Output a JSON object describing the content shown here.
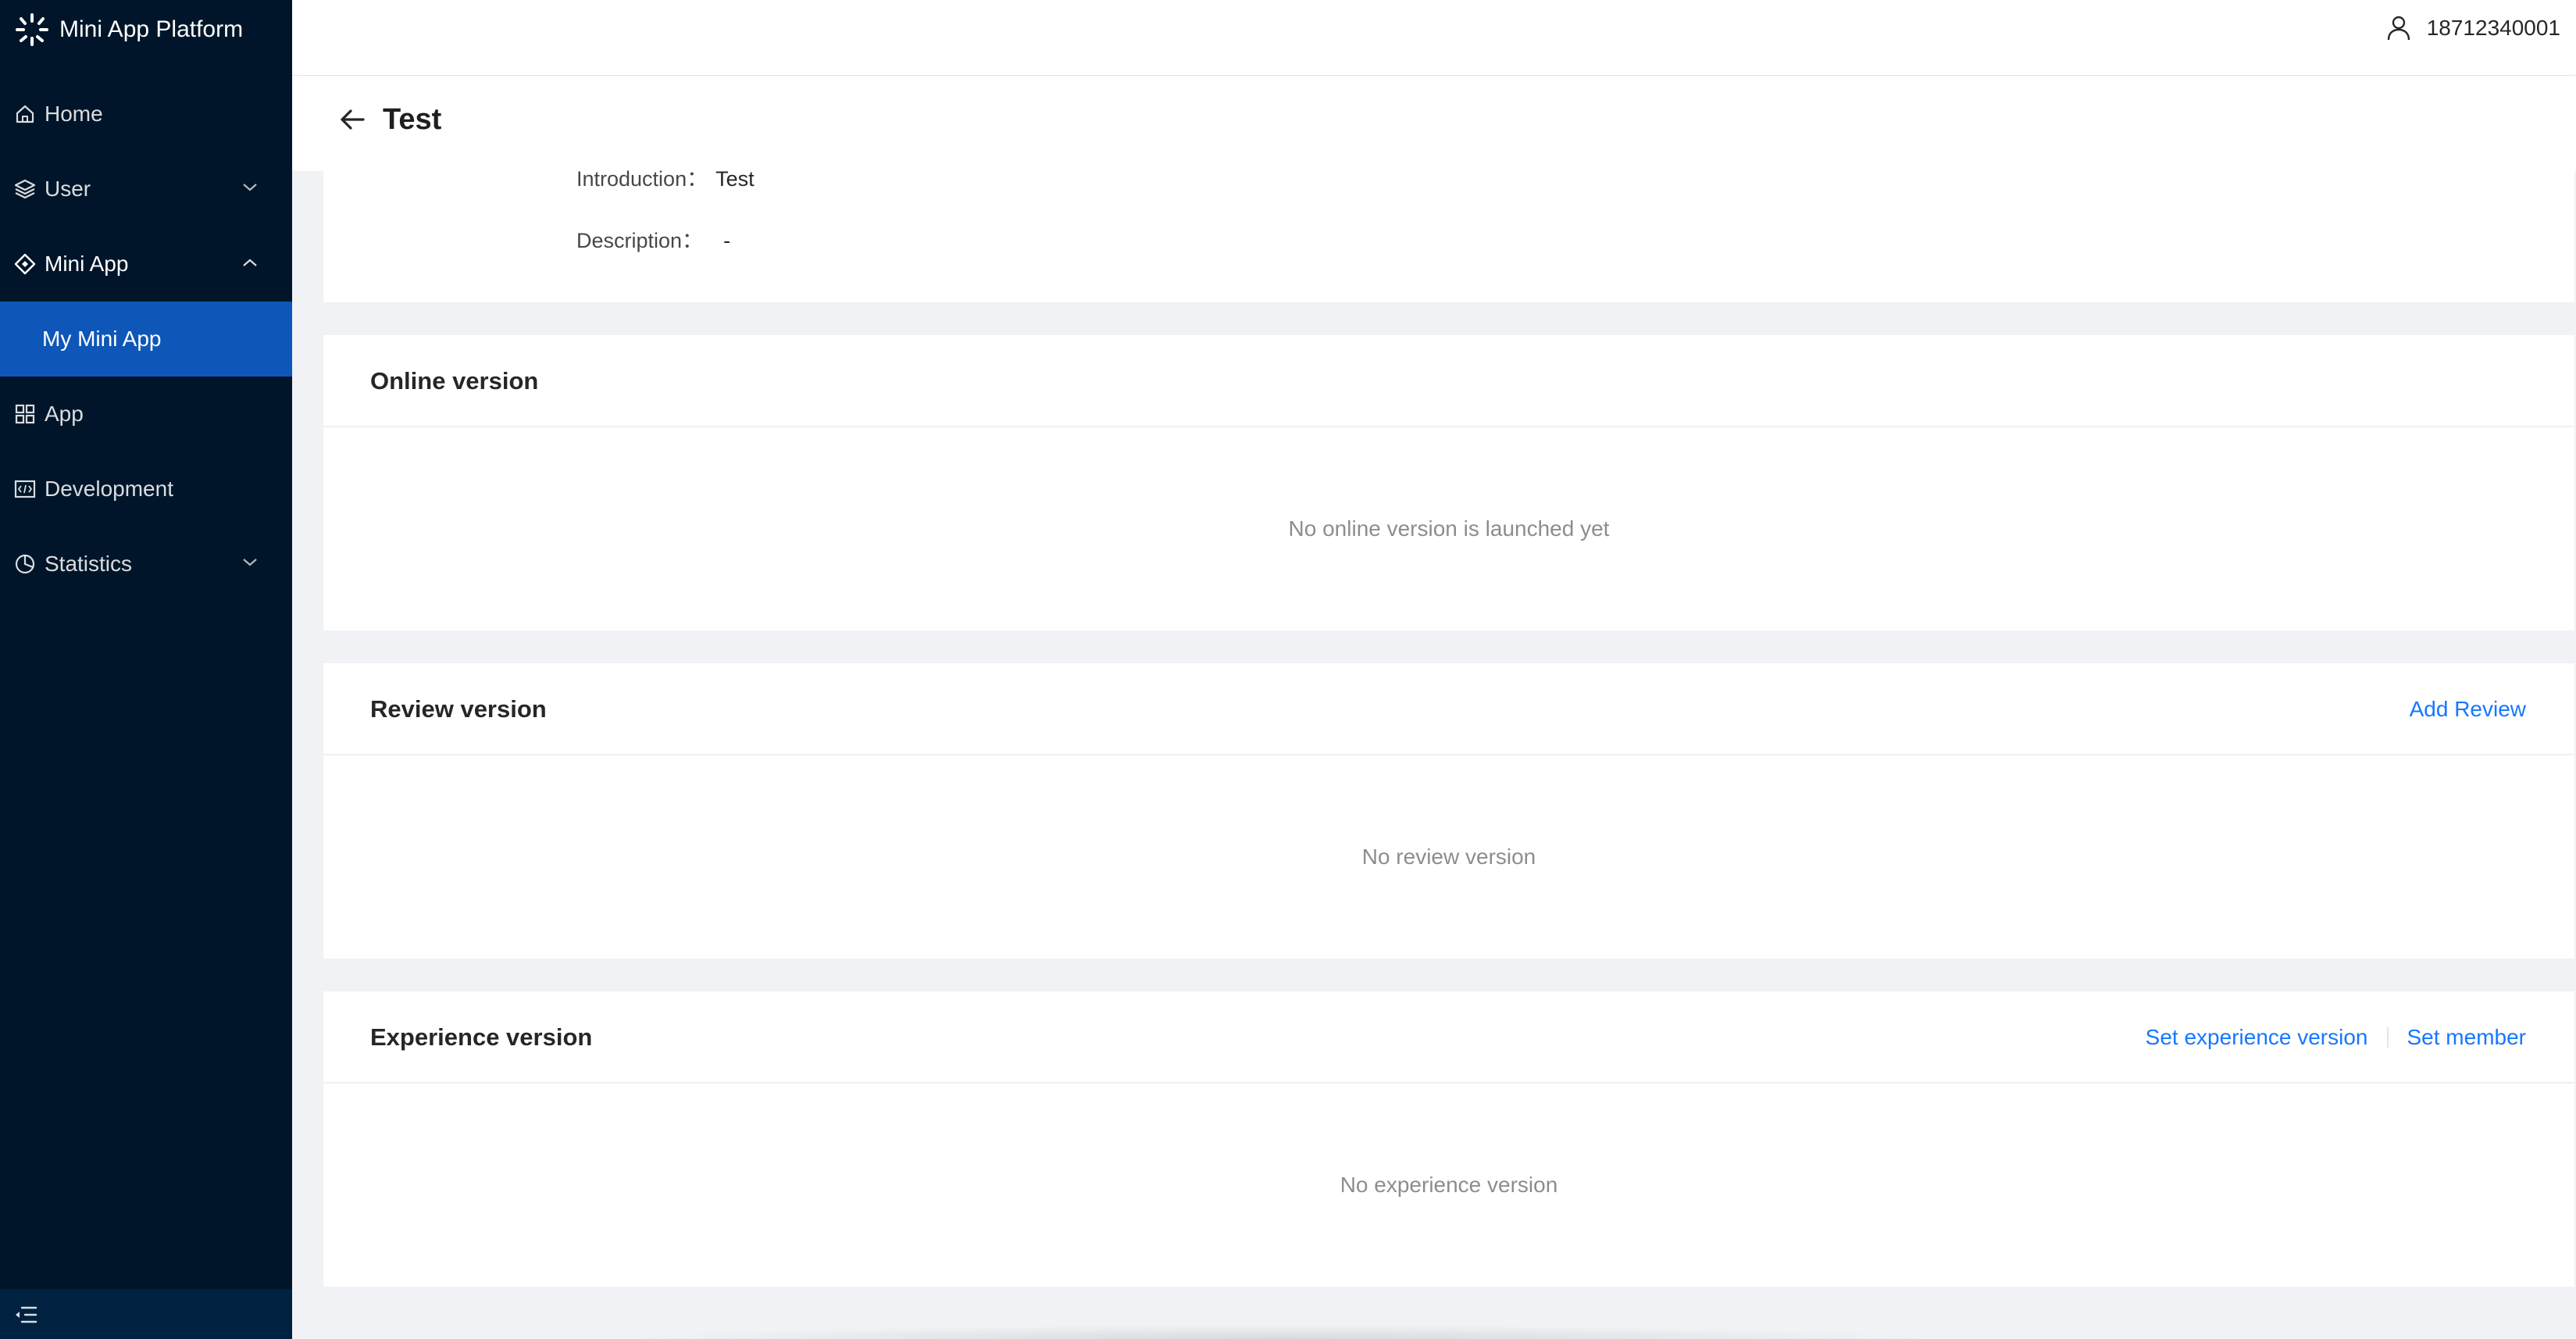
{
  "brand": {
    "name": "Mini App Platform"
  },
  "sidebar": {
    "items": [
      {
        "label": "Home",
        "icon": "home-icon"
      },
      {
        "label": "User",
        "icon": "layers-icon",
        "expanded": false
      },
      {
        "label": "Mini App",
        "icon": "diamond-icon",
        "expanded": true,
        "children": [
          {
            "label": "My Mini App",
            "selected": true
          }
        ]
      },
      {
        "label": "App",
        "icon": "grid-icon"
      },
      {
        "label": "Development",
        "icon": "code-icon"
      },
      {
        "label": "Statistics",
        "icon": "pie-chart-icon",
        "expanded": false
      }
    ],
    "collapse_icon": "menu-fold-icon",
    "colors": {
      "background": "#001529",
      "selected": "#0e57b8"
    }
  },
  "header": {
    "user": "18712340001",
    "user_icon": "user-icon"
  },
  "page": {
    "title": "Test",
    "back_icon": "arrow-left-icon",
    "info": {
      "introduction_label": "Introduction：",
      "introduction_value": "Test",
      "description_label": "Description：",
      "description_value": "-"
    }
  },
  "cards": {
    "online": {
      "title": "Online version",
      "empty": "No online version is launched yet"
    },
    "review": {
      "title": "Review version",
      "action": "Add Review",
      "empty": "No review version"
    },
    "experience": {
      "title": "Experience version",
      "actions": [
        "Set experience version",
        "Set member"
      ],
      "empty": "No experience version"
    }
  },
  "colors": {
    "link": "#1677ff",
    "page_bg": "#f0f2f5"
  }
}
